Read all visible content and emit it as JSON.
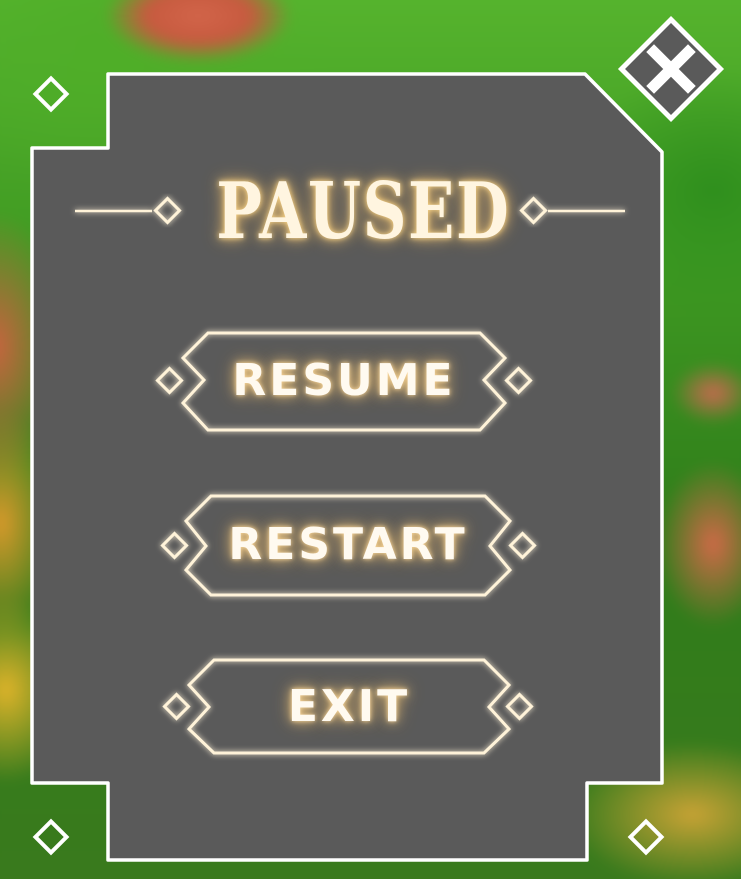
{
  "menu": {
    "title": "PAUSED",
    "buttons": [
      {
        "id": "resume",
        "label": "RESUME"
      },
      {
        "id": "restart",
        "label": "RESTART"
      },
      {
        "id": "exit",
        "label": "EXIT"
      }
    ]
  },
  "icons": {
    "close": "close-x-icon",
    "decor": "diamond-icon"
  },
  "colors": {
    "panel": "#5a5a5a",
    "outline": "#ffffff",
    "glow": "#ffd98a",
    "background": "#3f9a22"
  }
}
